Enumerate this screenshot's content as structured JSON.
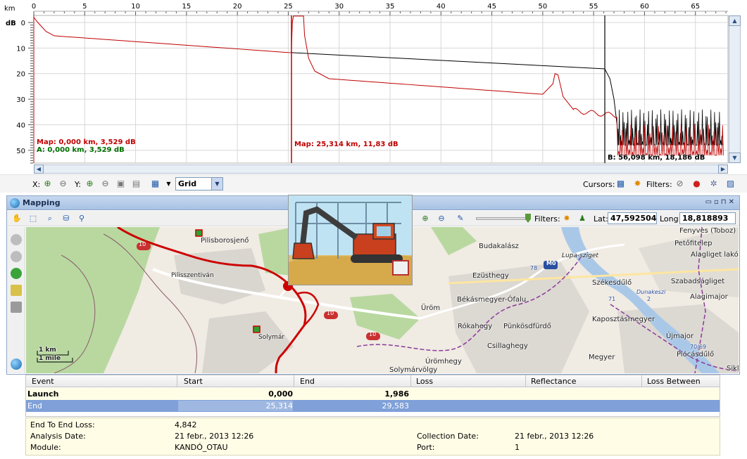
{
  "trace": {
    "x_unit": "km",
    "y_unit": "dB",
    "x_ticks": [
      "0",
      "5",
      "10",
      "15",
      "20",
      "25",
      "30",
      "35",
      "40",
      "45",
      "50",
      "55",
      "60",
      "65"
    ],
    "y_ticks": [
      "0",
      "10",
      "20",
      "30",
      "40",
      "50"
    ],
    "x_range_km": [
      0,
      68.2
    ],
    "y_range_db": [
      0,
      55
    ],
    "cursor_a_label": "A: 0,000 km, 3,529 dB",
    "map_label_1": "Map: 0,000 km, 3,529 dB",
    "map_label_2": "Map: 25,314 km, 11,83 dB",
    "cursor_b_label": "B: 56,098 km, 18,186 dB",
    "colors": {
      "red_trace": "#c00000",
      "black_trace": "#000000",
      "grid": "#d8d8d8",
      "cursor_a": "#007000"
    }
  },
  "trace_toolbar": {
    "x_label": "X:",
    "y_label": "Y:",
    "view_select": "Grid",
    "cursors_label": "Cursors:",
    "filters_label": "Filters:"
  },
  "mapping": {
    "title": "Mapping",
    "filters_label": "Filters:",
    "lat_label": "Lat:",
    "lat_value": "47,592504",
    "long_label": "Long:",
    "long_value": "18,818893",
    "scale_km": "1 km",
    "scale_mile": "1 mile",
    "places": [
      "Pilisborosjenő",
      "Fenyves (Toboz)",
      "Petőfitelep",
      "Alagliget lakóp",
      "Budakalász",
      "Lupa-sziget",
      "Ezüsthegy",
      "Székesdűlő",
      "Szabadságliget",
      "Alagimajor",
      "Pilisszentiván",
      "Üröm",
      "Békásmegyer-Ófalu",
      "Kaposztásmegyer",
      "Rókahegy",
      "Pünkösdfürdő",
      "Újmajor",
      "Solymár",
      "Csillaghegy",
      "Megyer",
      "Piócásdűlő",
      "Úrömhegy",
      "Solymárvölgy",
      "Sikl",
      "Pilisszentiván",
      "10",
      "10",
      "10",
      "M0",
      "78",
      "71",
      "2",
      "70/69",
      "Dunakeszi"
    ]
  },
  "events": {
    "headers": [
      "Event",
      "Start",
      "End",
      "Loss",
      "Reflectance",
      "Loss Between"
    ],
    "rows": [
      {
        "event": "Launch",
        "start": "0,000",
        "end": "1,986",
        "loss": "",
        "reflectance": "",
        "loss_between": ""
      },
      {
        "event": "End",
        "start": "25,314",
        "end": "29,583",
        "loss": "",
        "reflectance": "",
        "loss_between": ""
      }
    ]
  },
  "summary": {
    "end_to_end_loss_label": "End To End Loss:",
    "end_to_end_loss_value": "4,842",
    "analysis_date_label": "Analysis Date:",
    "analysis_date_value": "21 febr., 2013 12:26",
    "module_label": "Module:",
    "module_value": "KANDÓ_OTAU",
    "collection_date_label": "Collection Date:",
    "collection_date_value": "21 febr., 2013 12:26",
    "port_label": "Port:",
    "port_value": "1"
  }
}
